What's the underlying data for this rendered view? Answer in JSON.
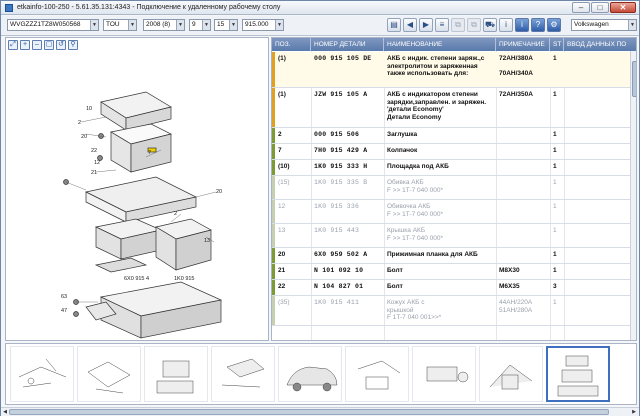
{
  "window": {
    "title": "etkainfo-100-250 - 5.61.35.131:4343 - Подключение к удаленному рабочему столу"
  },
  "toolbar": {
    "vin": "WVGZZZ1TZ8W050568",
    "model": "TOU",
    "year": "2008 (8)",
    "group": "9",
    "subgroup": "15",
    "illustration": "915.000",
    "brand": "Volkswagen"
  },
  "table": {
    "headers": {
      "pos": "ПОЗ.",
      "part": "НОМЕР ДЕТАЛИ",
      "name": "НАИМЕНОВАНИЕ",
      "note": "ПРИМЕЧАНИЕ",
      "st": "ST",
      "entry": "ВВОД ДАННЫХ ПО"
    },
    "rows": [
      {
        "pos": "(1)",
        "part": "000 915 105 DE",
        "name": "АКБ с индик. степени заряж.,с\nэлектролитом и заряженная\nтакже использовать для:",
        "note": "72AH/380A\n\n70AH/340A",
        "st": "1",
        "mark": "#e0a020"
      },
      {
        "pos": "(1)",
        "part": "JZW 915 105 A",
        "name": "АКБ с индикатором степени\nзарядки,заправлен. и заряжен.\n'детали Economy'\nДетали Economy",
        "note": "72AH/350A",
        "st": "1",
        "mark": "#e0a020"
      },
      {
        "pos": "2",
        "part": "000 915 506",
        "name": "Заглушка",
        "note": "",
        "st": "1",
        "mark": "#7c9a36"
      },
      {
        "pos": "7",
        "part": "7H0 915 429 A",
        "name": "Колпачок",
        "note": "",
        "st": "1",
        "mark": "#7c9a36"
      },
      {
        "pos": "(10)",
        "part": "1K0 915 333 H",
        "name": "Площадка под АКБ",
        "note": "",
        "st": "1",
        "mark": "#7c9a36"
      },
      {
        "pos": "(15)",
        "part": "1K0 915 335 B",
        "name": "Обивка АКБ\nF >> 1T-7 040 000*",
        "note": "",
        "st": "1",
        "mark": "#c6cfb0",
        "dim": true
      },
      {
        "pos": "12",
        "part": "1K0 915 336",
        "name": "Обивочка АКБ\nF >> 1T-7 040 000*",
        "note": "",
        "st": "1",
        "mark": "#c6cfb0",
        "dim": true
      },
      {
        "pos": "13",
        "part": "1K0 915 443",
        "name": "Крышка АКБ\nF >> 1T-7 040 000*",
        "note": "",
        "st": "1",
        "mark": "#c6cfb0",
        "dim": true
      },
      {
        "pos": "20",
        "part": "6X0 959 502 A",
        "name": "Прижимная планка для АКБ",
        "note": "",
        "st": "1",
        "mark": "#7c9a36"
      },
      {
        "pos": "21",
        "part": "N 101 092 10",
        "name": "Болт",
        "note": "M8X30",
        "st": "1",
        "mark": "#7c9a36"
      },
      {
        "pos": "22",
        "part": "N 104 827 01",
        "name": "Болт",
        "note": "M6X35",
        "st": "3",
        "mark": "#7c9a36"
      },
      {
        "pos": "(35)",
        "part": "1K0 915 411",
        "name": "Кожух АКБ с\nкрышкой\nF 1T-7 040 001>>*",
        "note": "44AH/220A\n51AH/280A",
        "st": "1",
        "mark": "#c6cfb0",
        "dim": true
      }
    ]
  },
  "icons": {
    "zoom": [
      "zoom-fit-icon",
      "zoom-in-icon",
      "zoom-out-icon",
      "zoom-window-icon",
      "zoom-reset-icon",
      "search-icon"
    ]
  }
}
